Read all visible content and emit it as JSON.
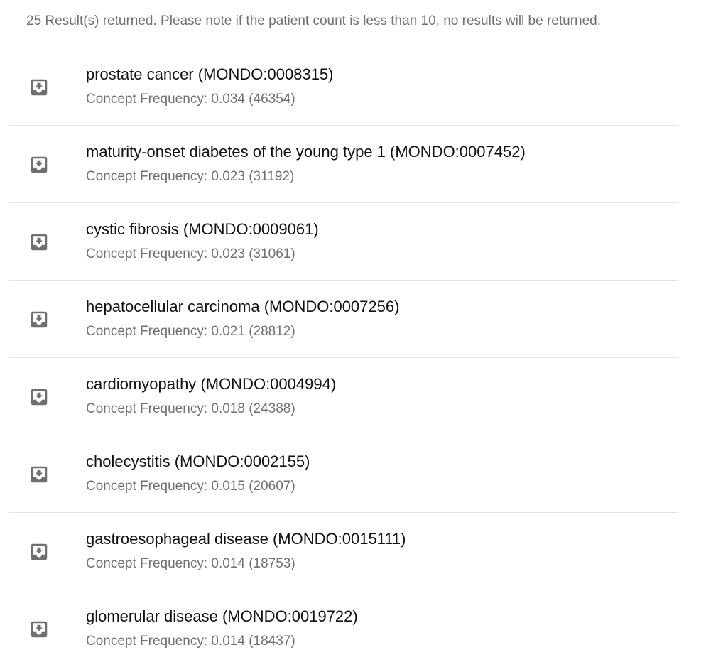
{
  "summary": "25 Result(s) returned. Please note if the patient count is less than 10, no results will be returned.",
  "results": [
    {
      "title": "prostate cancer (MONDO:0008315)",
      "frequency": "Concept Frequency: 0.034 (46354)"
    },
    {
      "title": "maturity-onset diabetes of the young type 1 (MONDO:0007452)",
      "frequency": "Concept Frequency: 0.023 (31192)"
    },
    {
      "title": "cystic fibrosis (MONDO:0009061)",
      "frequency": "Concept Frequency: 0.023 (31061)"
    },
    {
      "title": "hepatocellular carcinoma (MONDO:0007256)",
      "frequency": "Concept Frequency: 0.021 (28812)"
    },
    {
      "title": "cardiomyopathy (MONDO:0004994)",
      "frequency": "Concept Frequency: 0.018 (24388)"
    },
    {
      "title": "cholecystitis (MONDO:0002155)",
      "frequency": "Concept Frequency: 0.015 (20607)"
    },
    {
      "title": "gastroesophageal disease (MONDO:0015111)",
      "frequency": "Concept Frequency: 0.014 (18753)"
    },
    {
      "title": "glomerular disease (MONDO:0019722)",
      "frequency": "Concept Frequency: 0.014 (18437)"
    }
  ],
  "icon": "move-to-inbox-icon",
  "colors": {
    "icon": "#6f6f6f",
    "title": "#111111",
    "muted": "#707070",
    "divider": "#e3e3e3"
  }
}
